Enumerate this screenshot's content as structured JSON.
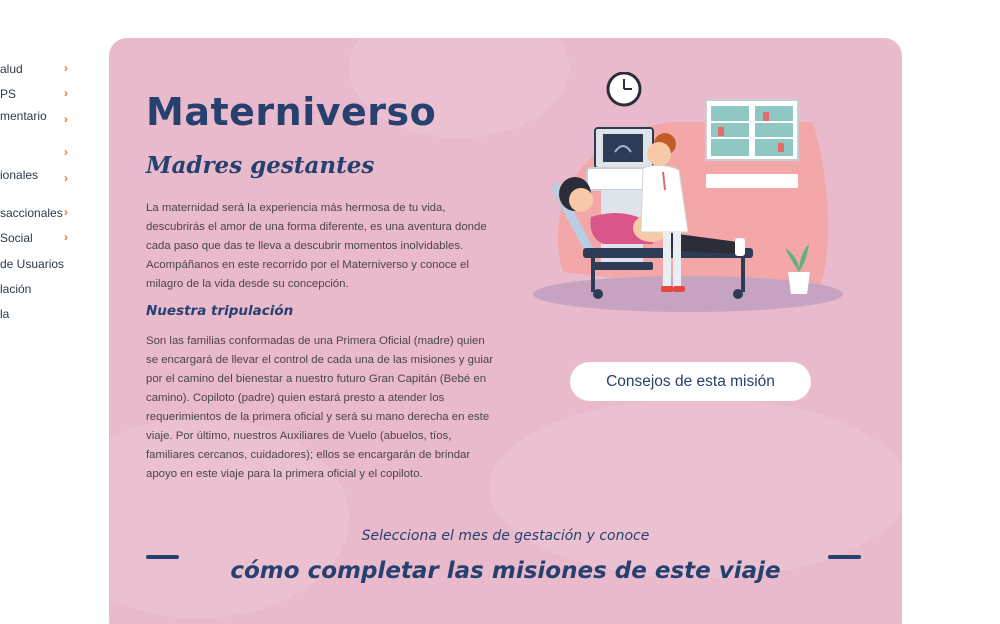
{
  "sidebar": {
    "items": [
      {
        "label": "alud",
        "has_chevron": true
      },
      {
        "label": "PS",
        "has_chevron": true
      },
      {
        "label": "mentario",
        "has_chevron": true
      },
      {
        "label": "",
        "has_chevron": true
      },
      {
        "label": "ionales",
        "has_chevron": true
      },
      {
        "label": "saccionales",
        "has_chevron": true
      },
      {
        "label": "Social",
        "has_chevron": true
      },
      {
        "label": "de Usuarios",
        "has_chevron": false
      },
      {
        "label": "lación",
        "has_chevron": false
      },
      {
        "label": "la",
        "has_chevron": false
      }
    ],
    "chevron_color": "#ee7a2a"
  },
  "main": {
    "title": "Materniverso",
    "subtitle": "Madres gestantes",
    "intro_paragraph": "La maternidad será la experiencia más hermosa de tu vida, descubrirás el amor de una forma diferente, es una aventura donde cada paso que das te lleva a descubrir momentos inolvidables. Acompáñanos en este recorrido por el Materniverso y conoce el milagro de la vida desde su concepción.",
    "crew_heading": "Nuestra tripulación",
    "crew_paragraph": "Son las familias conformadas de una Primera Oficial (madre) quien se encargará de llevar el control de cada una de las misiones y guiar por el camino del bienestar a nuestro futuro Gran Capitán (Bebé en camino). Copiloto (padre) quien estará presto a atender los requerimientos de la primera oficial y será su mano derecha en este viaje. Por último, nuestros Auxiliares de Vuelo (abuelos, tíos, familiares cercanos, cuidadores); ellos se encargarán de brindar apoyo en este viaje para la primera oficial y el copiloto.",
    "tips_button": "Consejos de esta misión",
    "select_prompt": "Selecciona el mes de gestación y conoce",
    "select_heading": "cómo completar las misiones de este viaje"
  },
  "colors": {
    "card_background": "#e9b9cc",
    "accent_navy": "#26406f",
    "body_text": "#4b4450"
  },
  "illustration": "pregnant-woman-ultrasound-illustration"
}
